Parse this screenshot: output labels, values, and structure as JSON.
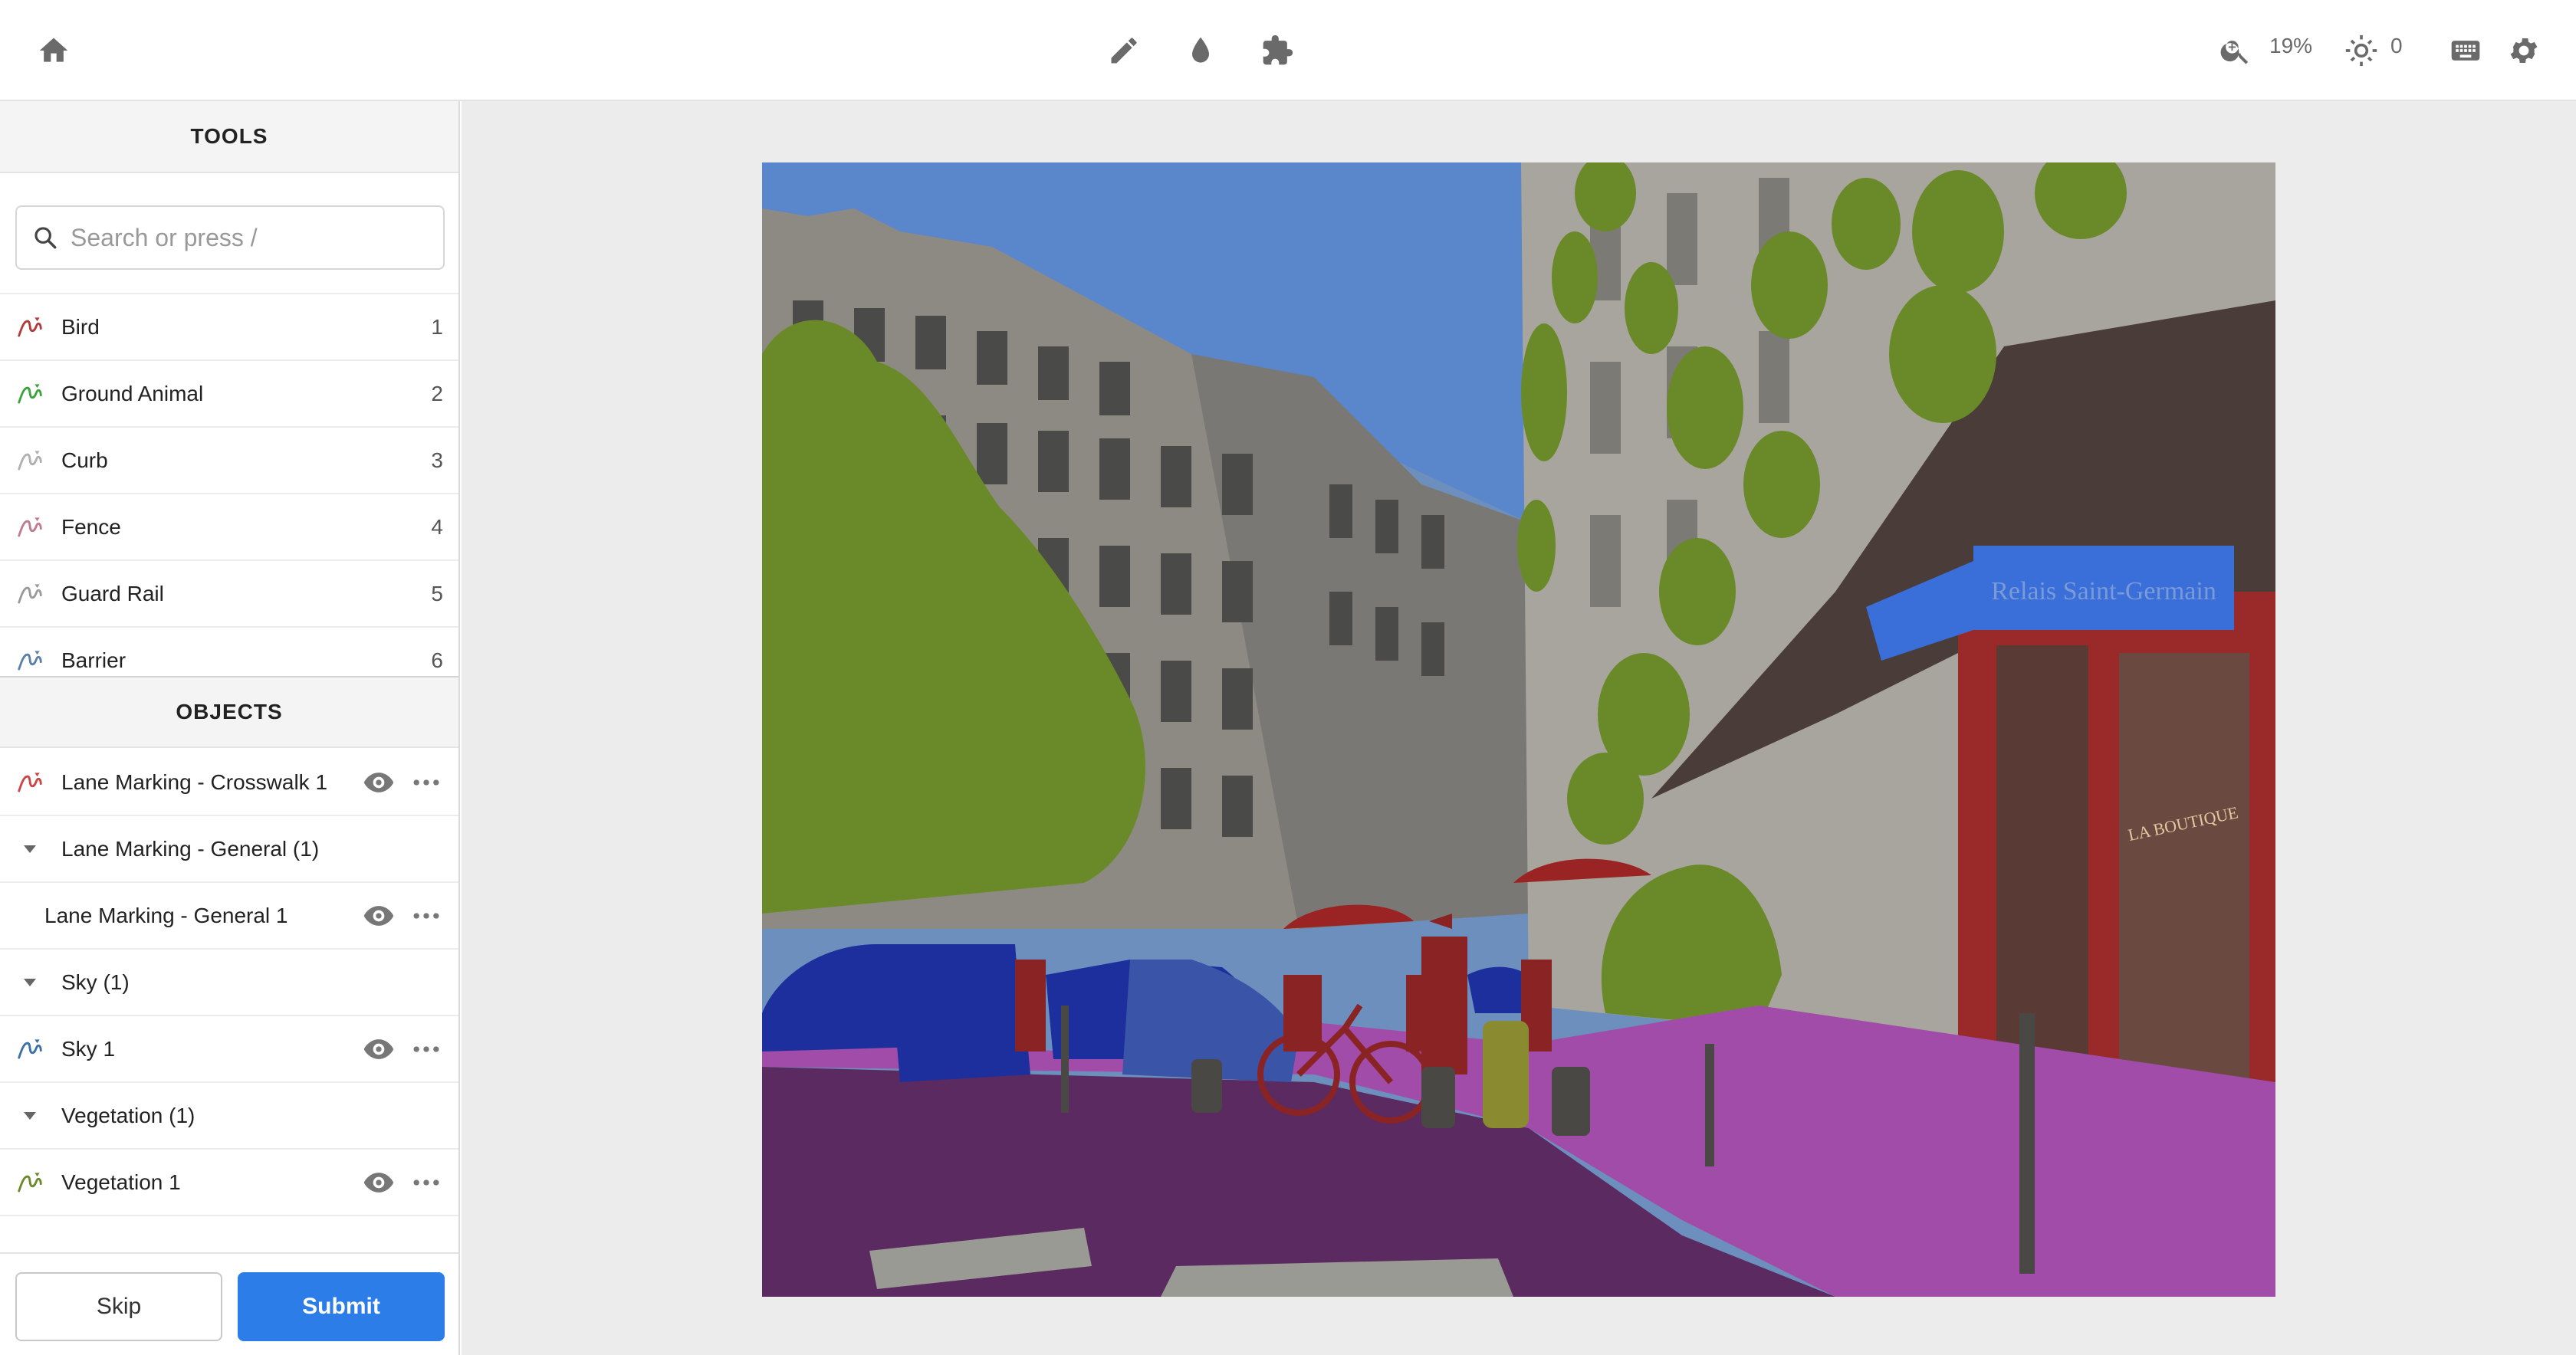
{
  "topbar": {
    "zoom": "19%",
    "brightness": "0"
  },
  "tools": {
    "header": "TOOLS",
    "search_placeholder": "Search or press /",
    "items": [
      {
        "label": "Bird",
        "key": "1",
        "color": "#b33a3a"
      },
      {
        "label": "Ground Animal",
        "key": "2",
        "color": "#3aa33a"
      },
      {
        "label": "Curb",
        "key": "3",
        "color": "#b0b0b0"
      },
      {
        "label": "Fence",
        "key": "4",
        "color": "#c27a8e"
      },
      {
        "label": "Guard Rail",
        "key": "5",
        "color": "#9a9a9a"
      },
      {
        "label": "Barrier",
        "key": "6",
        "color": "#5a7fa8"
      }
    ]
  },
  "objects": {
    "header": "OBJECTS",
    "items": [
      {
        "label": "Lane Marking - Crosswalk 1",
        "color": "#c44"
      },
      {
        "label": "Lane Marking - General (1)"
      },
      {
        "label": "Lane Marking - General 1"
      },
      {
        "label": "Sky (1)"
      },
      {
        "label": "Sky 1",
        "color": "#3a6fa8"
      },
      {
        "label": "Vegetation (1)"
      },
      {
        "label": "Vegetation 1",
        "color": "#6a8a2a"
      }
    ]
  },
  "footer": {
    "skip_label": "Skip",
    "submit_label": "Submit"
  },
  "image_text": {
    "sign": "Relais Saint-Germain",
    "shop": "LA BOUTIQUE"
  }
}
